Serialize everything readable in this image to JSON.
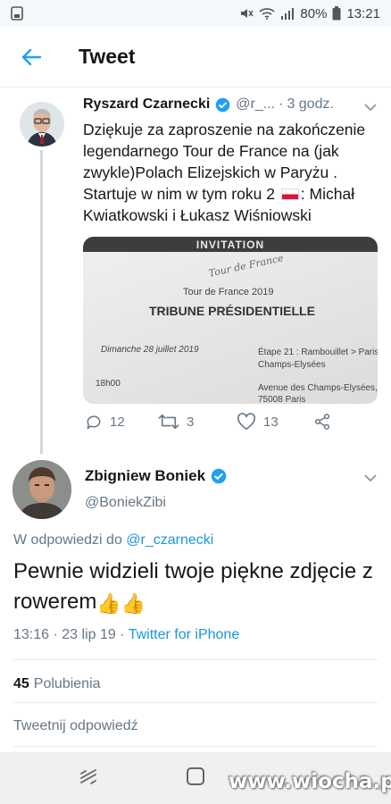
{
  "status_bar": {
    "battery": "80%",
    "time": "13:21"
  },
  "app_bar": {
    "title": "Tweet"
  },
  "parent_tweet": {
    "name": "Ryszard Czarnecki",
    "handle": "@r_...",
    "separator": "·",
    "time": "3 godz.",
    "text_1": "Dziękuje za zaproszenie na zakończenie legendarnego Tour de France na (jak zwykle)Polach Elizejskich w Paryżu . Startuje w nim w tym roku 2",
    "text_2": ": Michał Kwiatkowski i Łukasz Wiśniowski",
    "image": {
      "band": "INVITATION",
      "logo": "Tour de France",
      "subtitle": "Tour de France 2019",
      "title": "TRIBUNE PRÉSIDENTIELLE",
      "date": "Dimanche 28 juillet 2019",
      "time": "18h00",
      "stage": "Étape 21 : Rambouillet > Paris",
      "stage_2": "Champs-Elysées",
      "address": "Avenue des Champs-Elysées,",
      "address_2": "75008 Paris"
    },
    "replies": "12",
    "retweets": "3",
    "likes": "13"
  },
  "main_tweet": {
    "name": "Zbigniew Boniek",
    "handle": "@BoniekZibi",
    "reply_prefix": "W odpowiedzi do",
    "reply_to": "@r_czarnecki",
    "text": "Pewnie widzieli twoje piękne zdjęcie z rowerem",
    "emoji": "👍",
    "time": "13:16",
    "date": "23 lip 19",
    "separator": "·",
    "client": "Twitter for iPhone",
    "likes_count": "45",
    "likes_label": "Polubienia",
    "reply_placeholder": "Tweetnij odpowiedź"
  },
  "watermark": "www.wiocha.pl",
  "colors": {
    "accent": "#1da1f2",
    "link": "#1b95e0",
    "muted": "#657786",
    "text": "#14171a"
  }
}
